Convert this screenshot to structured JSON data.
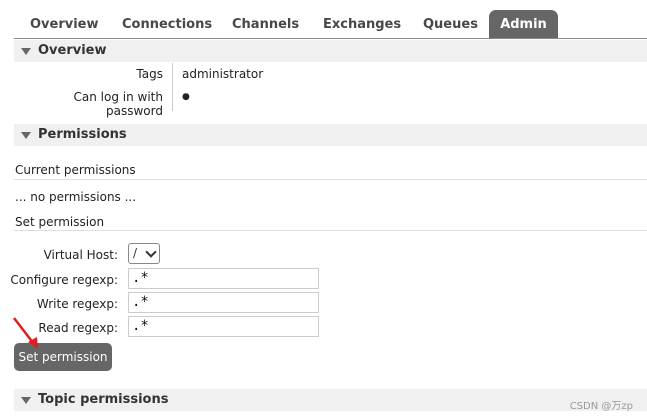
{
  "tabs": [
    "Overview",
    "Connections",
    "Channels",
    "Exchanges",
    "Queues",
    "Admin"
  ],
  "active_tab": "Admin",
  "overview": {
    "title": "Overview",
    "tags_label": "Tags",
    "tags_value": "administrator",
    "login_label": "Can log in with password",
    "login_value": "●"
  },
  "permissions": {
    "title": "Permissions",
    "current_heading": "Current permissions",
    "no_permissions": "... no permissions ...",
    "set_heading": "Set permission",
    "virtual_host_label": "Virtual Host:",
    "virtual_host_value": "/",
    "configure_label": "Configure regexp:",
    "configure_value": ".*",
    "write_label": "Write regexp:",
    "write_value": ".*",
    "read_label": "Read regexp:",
    "read_value": ".*",
    "button": "Set permission"
  },
  "topic_permissions": {
    "title": "Topic permissions"
  },
  "watermark": "CSDN @万zp",
  "colors": {
    "tab_active": "#666666",
    "section_bg": "#f0f0f0",
    "annotation_arrow": "#e02020"
  }
}
